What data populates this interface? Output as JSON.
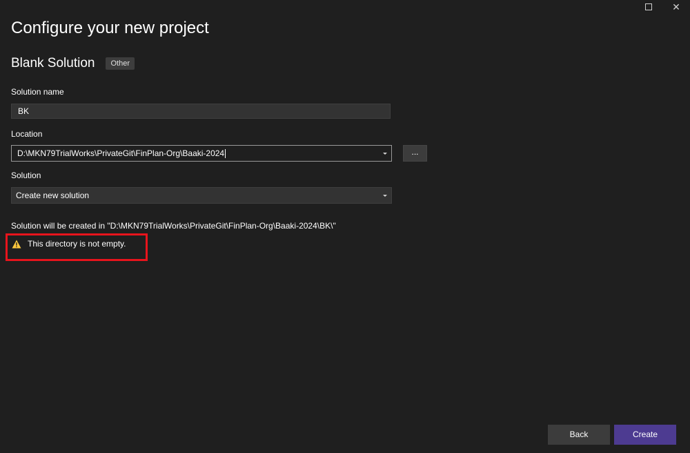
{
  "window": {
    "maximize_icon": "maximize-icon",
    "close_icon": "close-icon",
    "close_glyph": "✕"
  },
  "header": {
    "title": "Configure your new project"
  },
  "template": {
    "name": "Blank Solution",
    "tag": "Other"
  },
  "form": {
    "solution_name_label": "Solution name",
    "solution_name_value": "BK",
    "location_label": "Location",
    "location_value": "D:\\MKN79TrialWorks\\PrivateGit\\FinPlan-Org\\Baaki-2024",
    "browse_label": "...",
    "solution_label": "Solution",
    "solution_value": "Create new solution"
  },
  "info": {
    "created_path_text": "Solution will be created in \"D:\\MKN79TrialWorks\\PrivateGit\\FinPlan-Org\\Baaki-2024\\BK\\\"",
    "warning_text": "This directory is not empty.",
    "warning_icon": "warning-icon"
  },
  "footer": {
    "back_label": "Back",
    "create_label": "Create"
  },
  "colors": {
    "background": "#1f1f1f",
    "accent": "#4d3b91",
    "highlight_border": "#e8141c",
    "warning_icon": "#ffc83d"
  }
}
